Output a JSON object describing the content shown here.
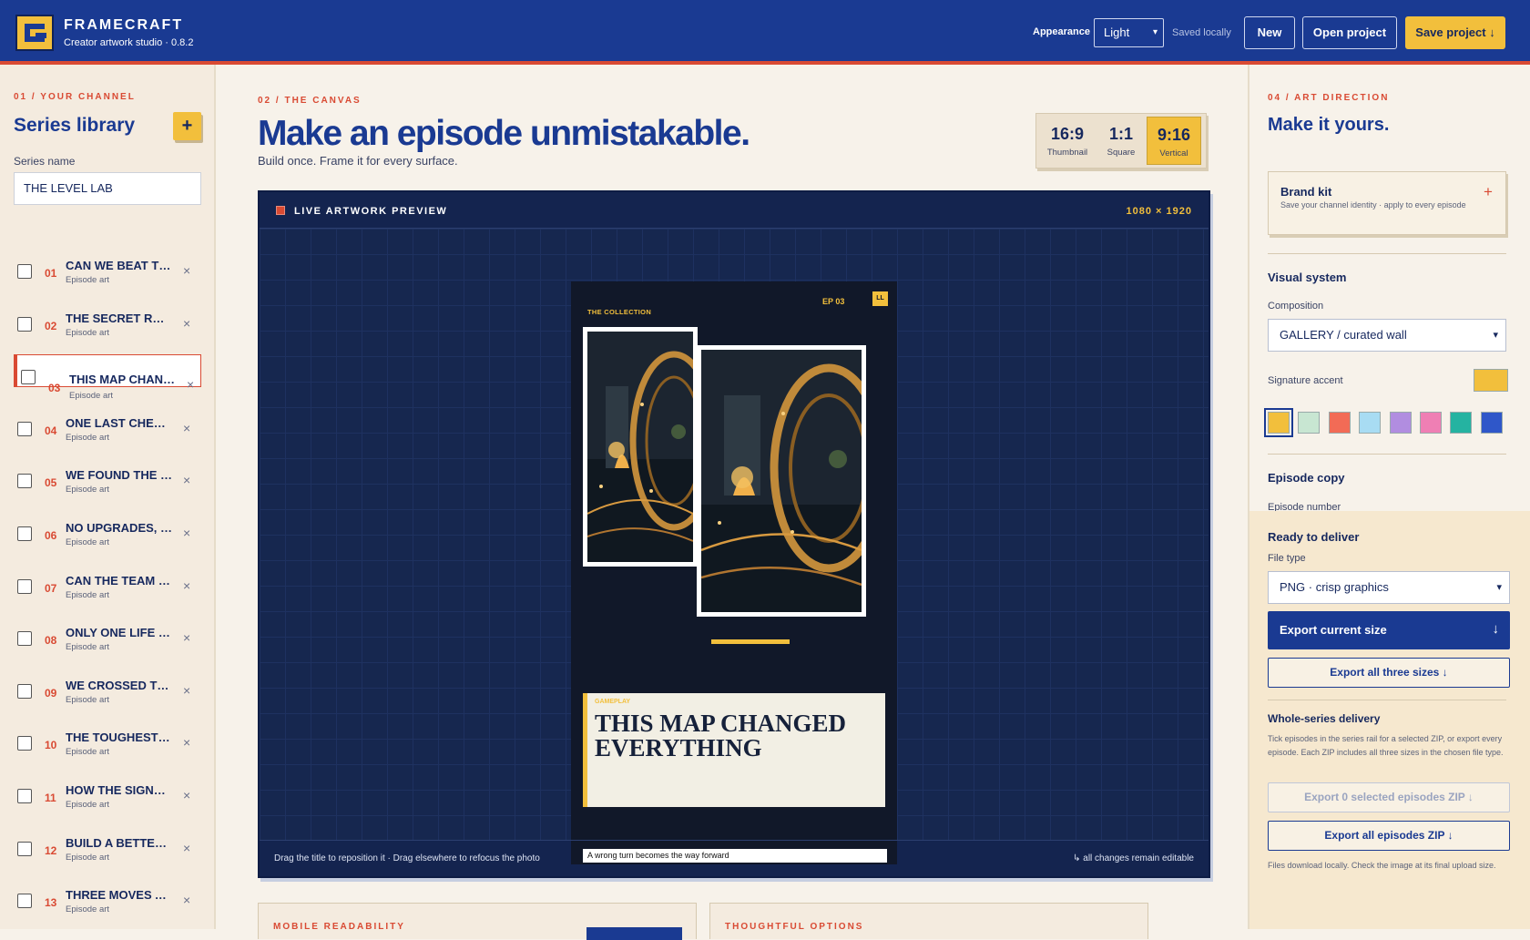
{
  "header": {
    "app_name": "FRAMECRAFT",
    "app_subtitle": "Creator artwork studio · 0.8.2",
    "appearance_label": "Appearance",
    "appearance_value": "Light",
    "saved_status": "Saved locally",
    "new_label": "New",
    "open_label": "Open project",
    "save_label": "Save project ↓"
  },
  "sidebar": {
    "kicker": "01 / YOUR CHANNEL",
    "title": "Series library",
    "add_label": "+",
    "series_name_label": "Series name",
    "series_name_value": "THE LEVEL LAB",
    "episodes": [
      {
        "num": "01",
        "title": "CAN WE BEAT THE GAME",
        "status": "Episode art",
        "selected": false
      },
      {
        "num": "02",
        "title": "THE SECRET ROOM",
        "status": "Episode art",
        "selected": false
      },
      {
        "num": "03",
        "title": "THIS MAP CHANGED EVERYTHING",
        "status": "Episode art",
        "selected": true
      },
      {
        "num": "04",
        "title": "ONE LAST CHECKPOINT",
        "status": "Episode art",
        "selected": false
      },
      {
        "num": "05",
        "title": "WE FOUND THE EXIT",
        "status": "Episode art",
        "selected": false
      },
      {
        "num": "06",
        "title": "NO UPGRADES, NO PROBLEM",
        "status": "Episode art",
        "selected": false
      },
      {
        "num": "07",
        "title": "CAN THE TEAM WIN",
        "status": "Episode art",
        "selected": false
      },
      {
        "num": "08",
        "title": "ONLY ONE LIFE LEFT",
        "status": "Episode art",
        "selected": false
      },
      {
        "num": "09",
        "title": "WE CROSSED THE LINE",
        "status": "Episode art",
        "selected": false
      },
      {
        "num": "10",
        "title": "THE TOUGHEST LEVEL",
        "status": "Episode art",
        "selected": false
      },
      {
        "num": "11",
        "title": "HOW THE SIGNAL WORKS",
        "status": "Episode art",
        "selected": false
      },
      {
        "num": "12",
        "title": "BUILD A BETTER BASE",
        "status": "Episode art",
        "selected": false
      },
      {
        "num": "13",
        "title": "THREE MOVES AHEAD",
        "status": "Episode art",
        "selected": false
      }
    ]
  },
  "canvas": {
    "kicker": "02 / THE CANVAS",
    "headline": "Make an episode unmistakable.",
    "subline": "Build once. Frame it for every surface.",
    "ratios": [
      {
        "value": "16:9",
        "name": "Thumbnail",
        "active": false
      },
      {
        "value": "1:1",
        "name": "Square",
        "active": false
      },
      {
        "value": "9:16",
        "name": "Vertical",
        "active": true
      }
    ],
    "preview_label": "LIVE ARTWORK PREVIEW",
    "dimensions": "1080 × 1920",
    "hint_left": "Drag the title to reposition it · Drag elsewhere to refocus the photo",
    "hint_right": "↳ all changes remain editable",
    "card_left": "MOBILE READABILITY",
    "card_right": "THOUGHTFUL OPTIONS"
  },
  "artwork": {
    "collection": "THE COLLECTION",
    "episode": "EP 03",
    "badge": "LL",
    "kicker": "GAMEPLAY",
    "title": "THIS MAP CHANGED EVERYTHING",
    "caption": "A wrong turn becomes the way forward"
  },
  "direction": {
    "kicker": "04 / ART DIRECTION",
    "title": "Make it yours.",
    "brand_kit_title": "Brand kit",
    "brand_kit_desc": "Save your channel identity · apply to every episode",
    "brand_kit_add": "+",
    "visual_system": "Visual system",
    "composition_label": "Composition",
    "composition_value": "GALLERY / curated wall",
    "accent_label": "Signature accent",
    "accent_color": "#f2bf3c",
    "swatches": [
      "#f2bf3c",
      "#c8e6d2",
      "#f26b56",
      "#a8dcf3",
      "#b18de0",
      "#ef7fb4",
      "#25b3a1",
      "#2f57c9"
    ],
    "episode_copy": "Episode copy",
    "episode_number_label": "Episode number",
    "episode_number_value": "3"
  },
  "deliver": {
    "title": "Ready to deliver",
    "file_type_label": "File type",
    "file_type_value": "PNG · crisp graphics",
    "export_current": "Export current size",
    "export_current_icon": "↓",
    "export_all_sizes": "Export all three sizes ↓",
    "series_title": "Whole-series delivery",
    "series_desc": "Tick episodes in the series rail for a selected ZIP, or export every episode. Each ZIP includes all three sizes in the chosen file type.",
    "export_selected": "Export 0 selected episodes ZIP ↓",
    "export_all_episodes": "Export all episodes ZIP ↓",
    "footnote": "Files download locally. Check the image at its final upload size."
  }
}
